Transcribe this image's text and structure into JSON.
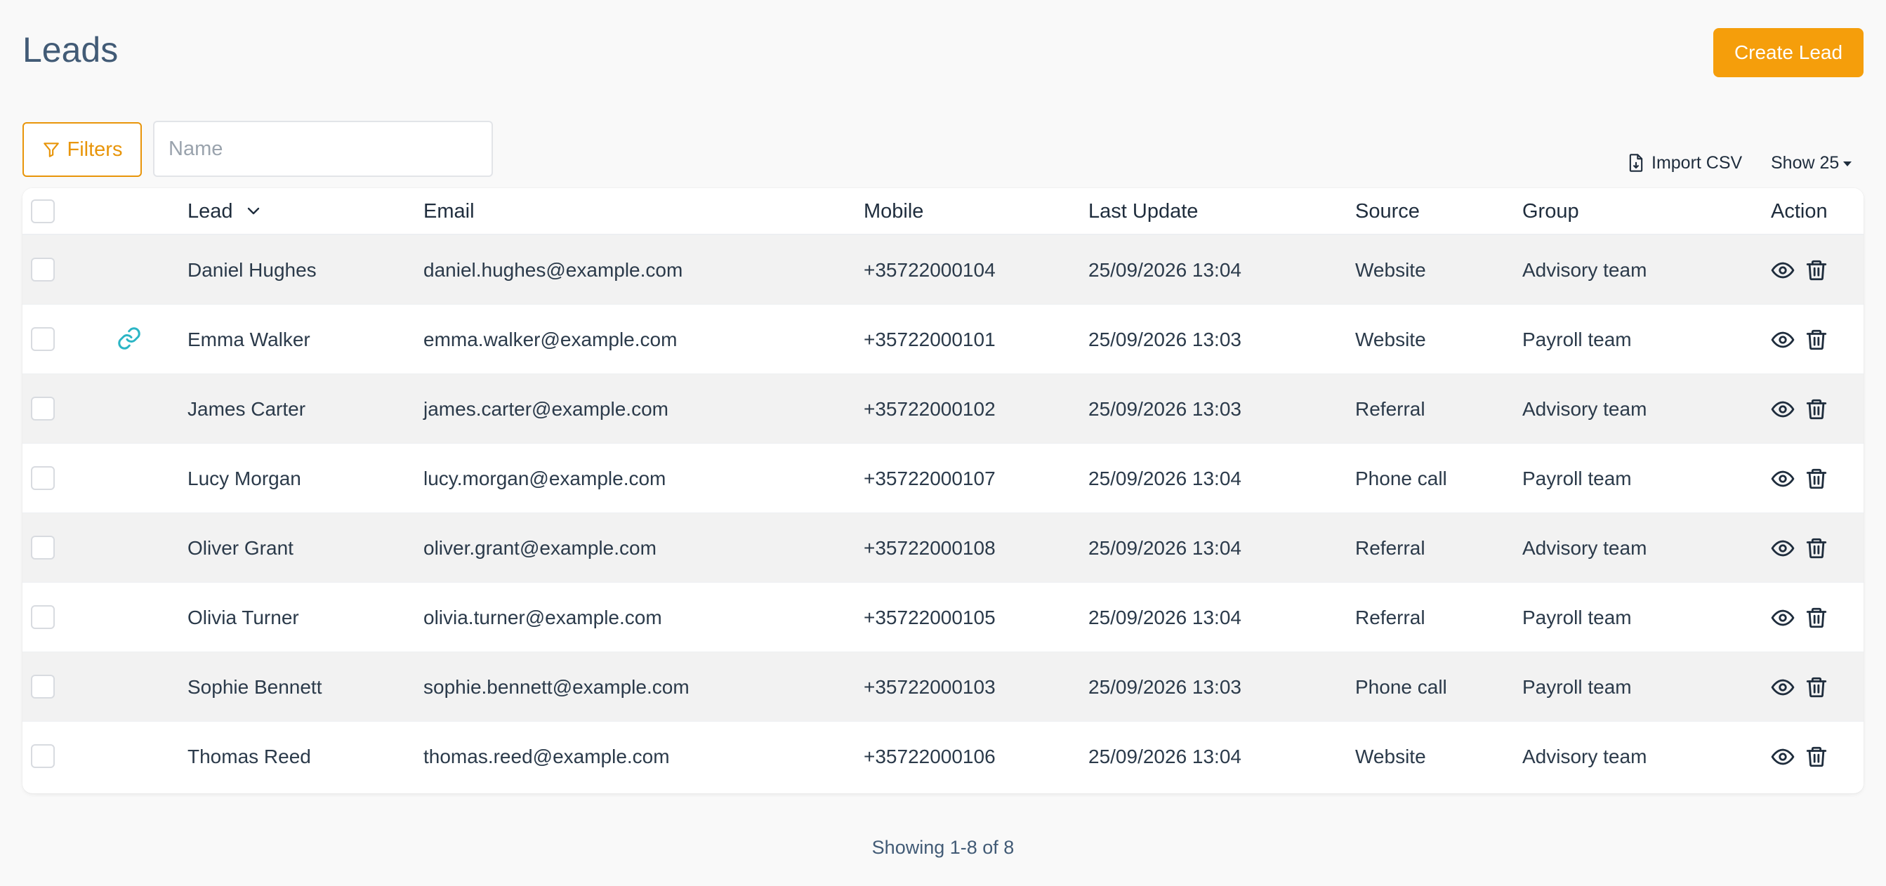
{
  "page": {
    "title": "Leads",
    "create_button": "Create Lead"
  },
  "toolbar": {
    "filters_label": "Filters",
    "name_placeholder": "Name",
    "name_value": "",
    "import_label": "Import CSV",
    "show_label": "Show 25"
  },
  "table": {
    "columns": {
      "lead": "Lead",
      "email": "Email",
      "mobile": "Mobile",
      "last_update": "Last Update",
      "source": "Source",
      "group": "Group",
      "action": "Action"
    },
    "rows": [
      {
        "lead": "Daniel Hughes",
        "email": "daniel.hughes@example.com",
        "mobile": "+35722000104",
        "last_update": "25/09/2026 13:04",
        "source": "Website",
        "group": "Advisory team",
        "linked": false
      },
      {
        "lead": "Emma Walker",
        "email": "emma.walker@example.com",
        "mobile": "+35722000101",
        "last_update": "25/09/2026 13:03",
        "source": "Website",
        "group": "Payroll team",
        "linked": true
      },
      {
        "lead": "James Carter",
        "email": "james.carter@example.com",
        "mobile": "+35722000102",
        "last_update": "25/09/2026 13:03",
        "source": "Referral",
        "group": "Advisory team",
        "linked": false
      },
      {
        "lead": "Lucy Morgan",
        "email": "lucy.morgan@example.com",
        "mobile": "+35722000107",
        "last_update": "25/09/2026 13:04",
        "source": "Phone call",
        "group": "Payroll team",
        "linked": false
      },
      {
        "lead": "Oliver Grant",
        "email": "oliver.grant@example.com",
        "mobile": "+35722000108",
        "last_update": "25/09/2026 13:04",
        "source": "Referral",
        "group": "Advisory team",
        "linked": false
      },
      {
        "lead": "Olivia Turner",
        "email": "olivia.turner@example.com",
        "mobile": "+35722000105",
        "last_update": "25/09/2026 13:04",
        "source": "Referral",
        "group": "Payroll team",
        "linked": false
      },
      {
        "lead": "Sophie Bennett",
        "email": "sophie.bennett@example.com",
        "mobile": "+35722000103",
        "last_update": "25/09/2026 13:03",
        "source": "Phone call",
        "group": "Payroll team",
        "linked": false
      },
      {
        "lead": "Thomas Reed",
        "email": "thomas.reed@example.com",
        "mobile": "+35722000106",
        "last_update": "25/09/2026 13:04",
        "source": "Website",
        "group": "Advisory team",
        "linked": false
      }
    ]
  },
  "footer": {
    "pagination_text": "Showing 1-8 of 8"
  },
  "colors": {
    "accent": "#f59e0b",
    "link_icon": "#2bb5c5",
    "title": "#425b76"
  },
  "icons": {
    "filter": "filter-icon",
    "import": "file-import-icon",
    "sort": "chevron-down-icon",
    "link": "link-icon",
    "view": "eye-icon",
    "delete": "trash-icon"
  }
}
